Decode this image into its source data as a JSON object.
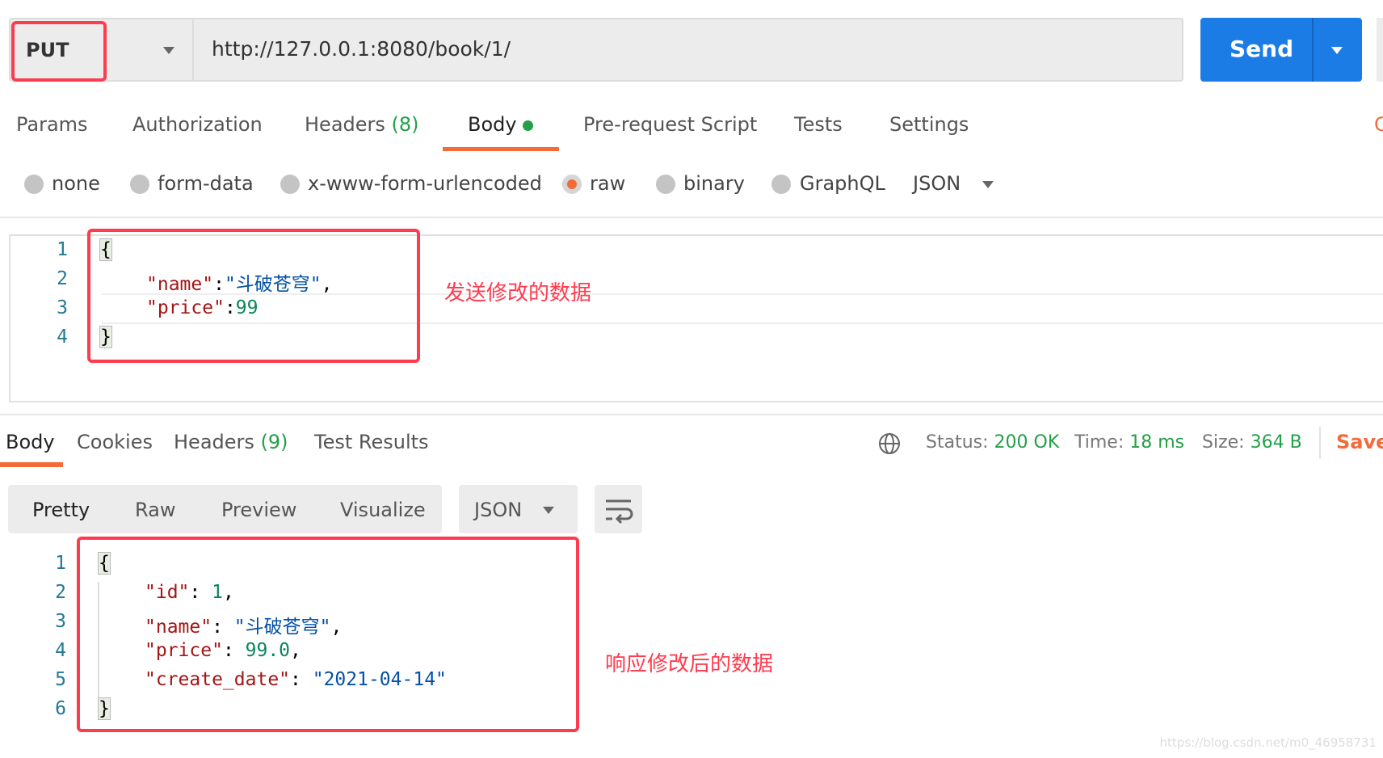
{
  "request": {
    "method": "PUT",
    "url": "http://127.0.0.1:8080/book/1/",
    "send_label": "Send"
  },
  "request_tabs": [
    {
      "label": "Params"
    },
    {
      "label": "Authorization"
    },
    {
      "label": "Headers",
      "count": "(8)"
    },
    {
      "label": "Body",
      "active": true
    },
    {
      "label": "Pre-request Script"
    },
    {
      "label": "Tests"
    },
    {
      "label": "Settings"
    },
    {
      "label": "C"
    }
  ],
  "body_types": [
    {
      "label": "none"
    },
    {
      "label": "form-data"
    },
    {
      "label": "x-www-form-urlencoded"
    },
    {
      "label": "raw",
      "selected": true
    },
    {
      "label": "binary"
    },
    {
      "label": "GraphQL"
    }
  ],
  "body_format": "JSON",
  "request_body_lines": [
    "1",
    "2",
    "3",
    "4"
  ],
  "request_body": {
    "name_key": "\"name\"",
    "name_val": "\"斗破苍穹\"",
    "price_key": "\"price\"",
    "price_val": "99"
  },
  "request_annotation": "发送修改的数据",
  "response_tabs": [
    {
      "label": "Body",
      "active": true
    },
    {
      "label": "Cookies"
    },
    {
      "label": "Headers",
      "count": "(9)"
    },
    {
      "label": "Test Results"
    }
  ],
  "response_status": {
    "status_label": "Status:",
    "status": "200 OK",
    "time_label": "Time:",
    "time": "18 ms",
    "size_label": "Size:",
    "size": "364 B",
    "save": "Save"
  },
  "view_modes": [
    "Pretty",
    "Raw",
    "Preview",
    "Visualize"
  ],
  "response_format": "JSON",
  "response_body_lines": [
    "1",
    "2",
    "3",
    "4",
    "5",
    "6"
  ],
  "response_body": {
    "id_key": "\"id\"",
    "id_val": "1",
    "name_key": "\"name\"",
    "name_val": "\"斗破苍穹\"",
    "price_key": "\"price\"",
    "price_val": "99.0",
    "date_key": "\"create_date\"",
    "date_val": "\"2021-04-14\""
  },
  "response_annotation": "响应修改后的数据",
  "watermark": "https://blog.csdn.net/m0_46958731",
  "colors": {
    "accent": "#f26b3a",
    "send": "#1b7ce6",
    "success": "#23a047",
    "annotation": "#ff3b4f"
  }
}
